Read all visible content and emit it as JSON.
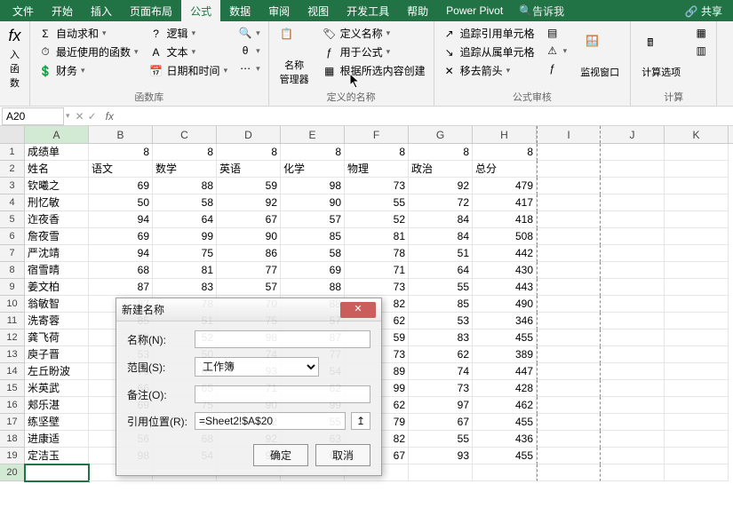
{
  "menu": {
    "tabs": [
      "文件",
      "开始",
      "插入",
      "页面布局",
      "公式",
      "数据",
      "审阅",
      "视图",
      "开发工具",
      "帮助",
      "Power Pivot"
    ],
    "active": 4,
    "tellme": "告诉我",
    "share": "共享"
  },
  "ribbon": {
    "g1": {
      "label": "函数库",
      "insertfn": "入函数",
      "autosum": "自动求和",
      "recent": "最近使用的函数",
      "financial": "财务",
      "logical": "逻辑",
      "text": "文本",
      "datetime": "日期和时间",
      "more1": "",
      "more2": "",
      "more3": ""
    },
    "g2": {
      "label": "定义的名称",
      "namemgr": "名称\n管理器",
      "define": "定义名称",
      "usefx": "用于公式",
      "create": "根据所选内容创建"
    },
    "g3": {
      "label": "公式审核",
      "traceprec": "追踪引用单元格",
      "tracedep": "追踪从属单元格",
      "remove": "移去箭头",
      "watch": "监视窗口"
    },
    "g4": {
      "label": "计算",
      "calcopt": "计算选项"
    }
  },
  "namebox": "A20",
  "chart_data": {
    "type": "table",
    "title": "成绩单",
    "eights_row": [
      8,
      8,
      8,
      8,
      8,
      8,
      8
    ],
    "columns": [
      "姓名",
      "语文",
      "数学",
      "英语",
      "化学",
      "物理",
      "政治",
      "总分"
    ],
    "rows": [
      [
        "钦曦之",
        69,
        88,
        59,
        98,
        73,
        92,
        479
      ],
      [
        "刑忆敏",
        50,
        58,
        92,
        90,
        55,
        72,
        417
      ],
      [
        "迮夜香",
        94,
        64,
        67,
        57,
        52,
        84,
        418
      ],
      [
        "詹夜雪",
        69,
        99,
        90,
        85,
        81,
        84,
        508
      ],
      [
        "严沈靖",
        94,
        75,
        86,
        58,
        78,
        51,
        442
      ],
      [
        "宿雪晴",
        68,
        81,
        77,
        69,
        71,
        64,
        430
      ],
      [
        "姜文柏",
        87,
        83,
        57,
        88,
        73,
        55,
        443
      ],
      [
        "翁敏智",
        87,
        78,
        70,
        88,
        82,
        85,
        490
      ],
      [
        "洗寄蓉",
        85,
        51,
        75,
        57,
        62,
        53,
        346
      ],
      [
        "龚飞荷",
        89,
        52,
        98,
        87,
        59,
        83,
        455
      ],
      [
        "庾子晋",
        53,
        50,
        74,
        77,
        73,
        62,
        389
      ],
      [
        "左丘盼波",
        79,
        65,
        93,
        54,
        89,
        74,
        447
      ],
      [
        "米英武",
        66,
        65,
        71,
        62,
        99,
        73,
        428
      ],
      [
        "郏乐湛",
        69,
        75,
        90,
        99,
        62,
        97,
        462
      ],
      [
        "练坚壁",
        93,
        53,
        82,
        55,
        79,
        67,
        455
      ],
      [
        "进康适",
        56,
        68,
        92,
        63,
        82,
        55,
        436
      ],
      [
        "定洁玉",
        98,
        54,
        98,
        63,
        67,
        93,
        455
      ]
    ]
  },
  "colletters": [
    "A",
    "B",
    "C",
    "D",
    "E",
    "F",
    "G",
    "H",
    "I",
    "J",
    "K"
  ],
  "dialog": {
    "title": "新建名称",
    "name_lbl": "名称(N):",
    "scope_lbl": "范围(S):",
    "scope_val": "工作簿",
    "comment_lbl": "备注(O):",
    "ref_lbl": "引用位置(R):",
    "ref_val": "=Sheet2!$A$20",
    "ok": "确定",
    "cancel": "取消"
  }
}
